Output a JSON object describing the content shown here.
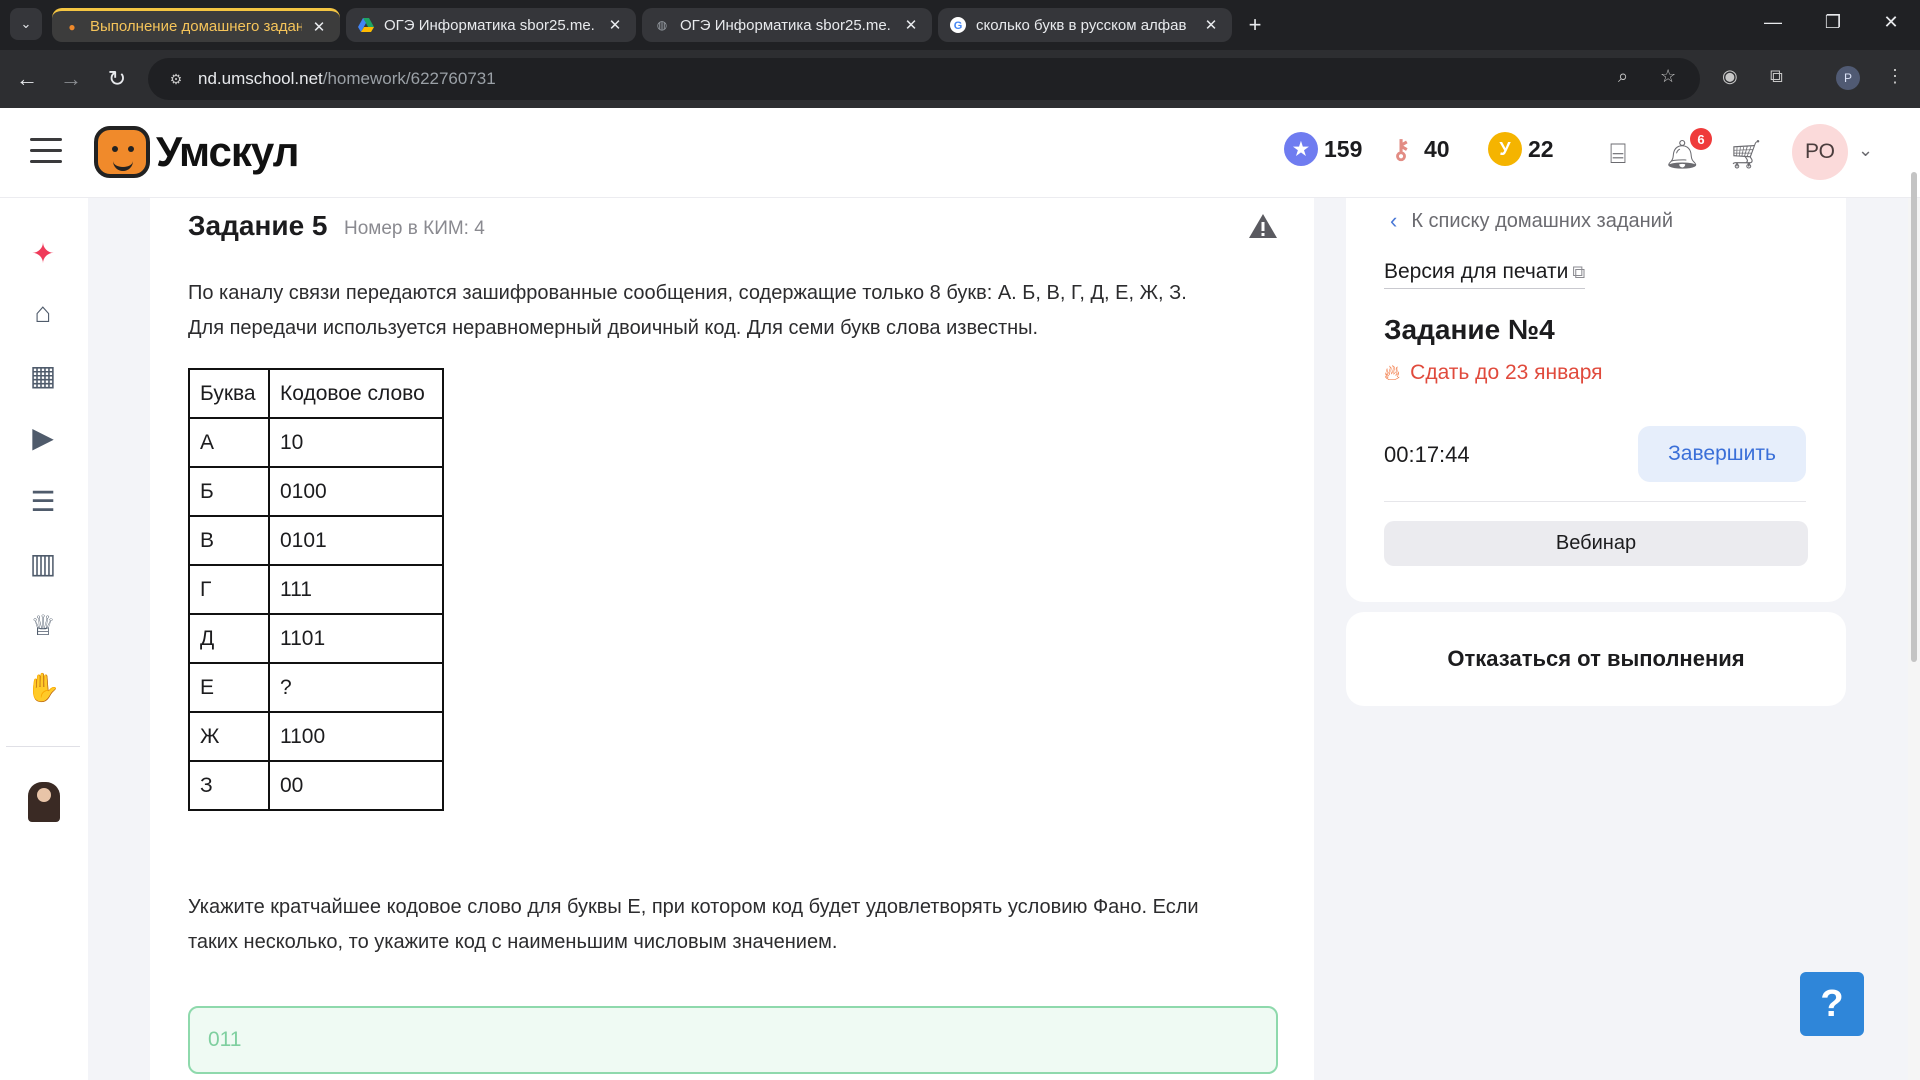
{
  "browser": {
    "tabs": [
      {
        "title": "Выполнение домашнего задан",
        "active": true
      },
      {
        "title": "ОГЭ Информатика sbor25.me.",
        "active": false
      },
      {
        "title": "ОГЭ Информатика sbor25.me.",
        "active": false
      },
      {
        "title": "сколько букв в русском алфав",
        "active": false
      }
    ],
    "url_host": "nd.umschool.net",
    "url_path": "/homework/622760731",
    "profile_initial": "P"
  },
  "header": {
    "logo_text": "Умскул",
    "stars": "159",
    "keys": "40",
    "coins": "22",
    "coin_symbol": "У",
    "notifications": "6",
    "avatar_initials": "РО"
  },
  "task": {
    "title": "Задание 5",
    "kim": "Номер в КИМ: 4",
    "text": "По каналу связи передаются зашифрованные сообщения, содержащие только 8 букв: А. Б, В, Г, Д, Е, Ж, З. Для передачи используется неравномерный двоичный код. Для семи букв слова известны.",
    "table": {
      "headers": [
        "Буква",
        "Кодовое слово"
      ],
      "rows": [
        [
          "А",
          "10"
        ],
        [
          "Б",
          "0100"
        ],
        [
          "В",
          "0101"
        ],
        [
          "Г",
          "111"
        ],
        [
          "Д",
          "1101"
        ],
        [
          "Е",
          "?"
        ],
        [
          "Ж",
          "1100"
        ],
        [
          "З",
          "00"
        ]
      ]
    },
    "question": "Укажите кратчайшее кодовое слово для буквы Е, при котором код будет удовлетворять условию Фано. Если таких несколько, то укажите код с наименьшим числовым значением.",
    "answer": "011"
  },
  "panel": {
    "back_label": "К списку домашних заданий",
    "print_label": "Версия для печати",
    "homework_title": "Задание №4",
    "deadline": "Сдать до 23 января",
    "timer": "00:17:44",
    "finish_label": "Завершить",
    "webinar_label": "Вебинар",
    "refuse_label": "Отказаться от выполнения"
  },
  "help_label": "?"
}
